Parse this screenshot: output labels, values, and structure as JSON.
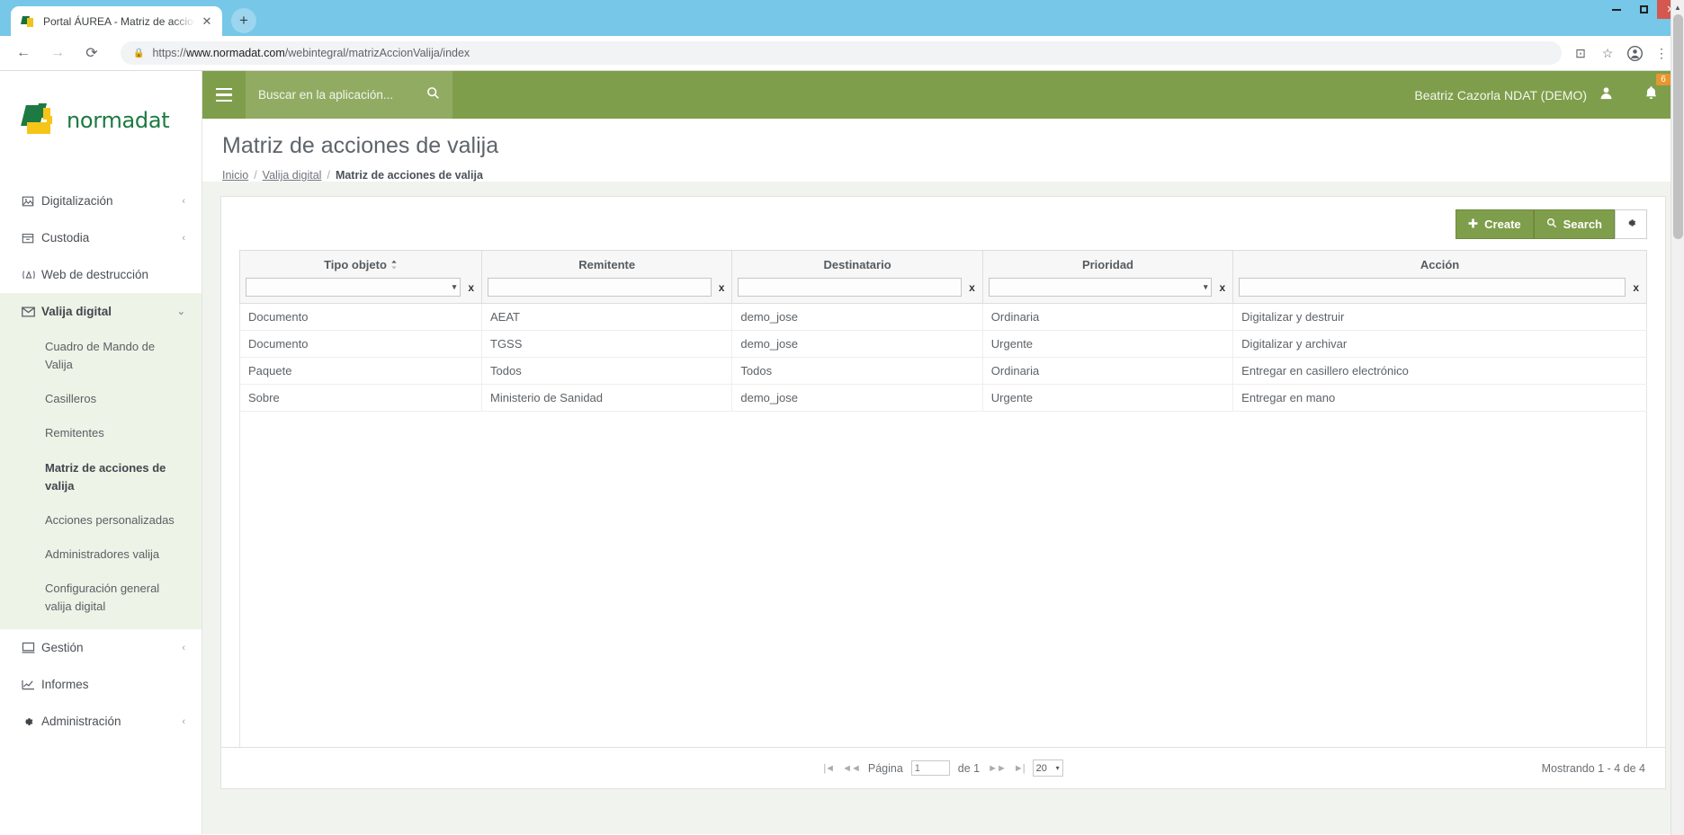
{
  "browser": {
    "tab_title": "Portal ÁUREA - Matriz de acciones",
    "tab_close_glyph": "✕",
    "newtab_glyph": "+",
    "back_glyph": "←",
    "forward_glyph": "→",
    "reload_glyph": "⟳",
    "lock_glyph": "🔒",
    "url_scheme": "https://",
    "url_host": "www.normadat.com",
    "url_path": "/webintegral/matrizAccionValija/index",
    "translate_glyph": "⊡",
    "bookmark_glyph": "☆",
    "profile_glyph": "●",
    "menu_glyph": "⋮",
    "minimize_glyph": "",
    "maximize_glyph": "",
    "close_glyph": "✕"
  },
  "sidebar": {
    "logo_text": "normadat",
    "items": [
      {
        "label": "Digitalización",
        "icon": "image-icon",
        "icon_glyph": "▣",
        "caret": "‹",
        "open": false
      },
      {
        "label": "Custodia",
        "icon": "archive-box-icon",
        "icon_glyph": "▤",
        "caret": "‹",
        "open": false
      },
      {
        "label": "Web de destrucción",
        "icon": "destruction-icon",
        "icon_glyph": "⒜",
        "caret": "",
        "open": false
      },
      {
        "label": "Valija digital",
        "icon": "envelope-icon",
        "icon_glyph": "✉",
        "caret": "⌄",
        "open": true
      },
      {
        "label": "Gestión",
        "icon": "monitor-icon",
        "icon_glyph": "▭",
        "caret": "‹",
        "open": false
      },
      {
        "label": "Informes",
        "icon": "chart-line-icon",
        "icon_glyph": "📈",
        "caret": "",
        "open": false
      },
      {
        "label": "Administración",
        "icon": "gear-icon",
        "icon_glyph": "✿",
        "caret": "‹",
        "open": false
      }
    ],
    "subitems": [
      {
        "label": "Cuadro de Mando de Valija",
        "active": false
      },
      {
        "label": "Casilleros",
        "active": false
      },
      {
        "label": "Remitentes",
        "active": false
      },
      {
        "label": "Matriz de acciones de valija",
        "active": true
      },
      {
        "label": "Acciones personalizadas",
        "active": false
      },
      {
        "label": "Administradores valija",
        "active": false
      },
      {
        "label": "Configuración general valija digital",
        "active": false
      }
    ]
  },
  "appbar": {
    "hamburger": "menu-icon",
    "search_placeholder": "Buscar en la aplicación...",
    "search_value": "",
    "search_icon_glyph": "🔍",
    "user_name": "Beatriz Cazorla NDAT (DEMO)",
    "user_icon_glyph": "👤",
    "bell_icon_glyph": "🔔",
    "notification_count": "6"
  },
  "page": {
    "title": "Matriz de acciones de valija",
    "breadcrumb": [
      {
        "label": "Inicio",
        "current": false
      },
      {
        "label": "Valija digital",
        "current": false
      },
      {
        "label": "Matriz de acciones de valija",
        "current": true
      }
    ],
    "breadcrumb_separator": "/"
  },
  "toolbar": {
    "create_label": "Create",
    "create_icon_glyph": "✚",
    "search_label": "Search",
    "search_icon_glyph": "🔍",
    "gear_icon_glyph": "✿"
  },
  "table": {
    "columns": [
      {
        "label": "Tipo objeto",
        "sortable": true,
        "filter_type": "select",
        "filter_value": ""
      },
      {
        "label": "Remitente",
        "sortable": false,
        "filter_type": "text",
        "filter_value": ""
      },
      {
        "label": "Destinatario",
        "sortable": false,
        "filter_type": "text",
        "filter_value": ""
      },
      {
        "label": "Prioridad",
        "sortable": false,
        "filter_type": "select",
        "filter_value": ""
      },
      {
        "label": "Acción",
        "sortable": false,
        "filter_type": "text",
        "filter_value": ""
      }
    ],
    "clear_glyph": "x",
    "dropdown_glyph": "▾",
    "rows": [
      [
        "Documento",
        "AEAT",
        "demo_jose",
        "Ordinaria",
        "Digitalizar y destruir"
      ],
      [
        "Documento",
        "TGSS",
        "demo_jose",
        "Urgente",
        "Digitalizar y archivar"
      ],
      [
        "Paquete",
        "Todos",
        "Todos",
        "Ordinaria",
        "Entregar en casillero electrónico"
      ],
      [
        "Sobre",
        "Ministerio de Sanidad",
        "demo_jose",
        "Urgente",
        "Entregar en mano"
      ]
    ]
  },
  "pager": {
    "first_glyph": "|◄",
    "prev_glyph": "◄◄",
    "page_label": "Página",
    "page_value": "1",
    "of_label": "de 1",
    "next_glyph": "►►",
    "last_glyph": "►|",
    "page_size": "20",
    "page_size_caret": "▾",
    "showing": "Mostrando 1 - 4 de 4"
  },
  "colors": {
    "brand_green": "#7f9e4b",
    "brand_green_light": "#91ab62",
    "logo_green": "#1d7a42",
    "logo_yellow": "#f5c518",
    "badge_orange": "#e8962f",
    "sidebar_active_bg": "#edf3e6"
  }
}
